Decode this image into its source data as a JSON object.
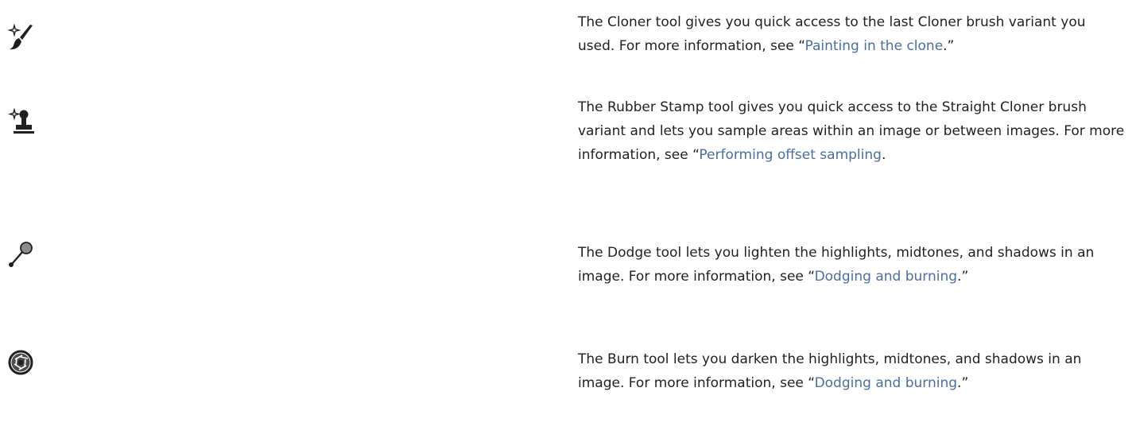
{
  "tools": [
    {
      "icon": "cloner-icon",
      "t1": "The ",
      "k1": "Cloner",
      "t2": " tool gives you quick access to the last Cloner brush variant you used. For more information, see “",
      "link": "Painting in the clone",
      "t3": ".”"
    },
    {
      "icon": "rubber-stamp-icon",
      "t1": "The ",
      "k1": "Rubber Stamp",
      "t2": " tool gives you quick access to the ",
      "k2": "Straight Cloner",
      "t3": " brush variant and lets you sample areas within an image or between images. For more information, see “",
      "link": "Performing offset sampling",
      "t4": "."
    },
    {
      "icon": "dodge-icon",
      "t1": "The ",
      "k1": "Dodge",
      "t2": " tool lets you lighten the highlights, midtones, and shadows in an image. For more information, see “",
      "link": "Dodging and burning",
      "t3": ".”"
    },
    {
      "icon": "burn-icon",
      "t1": "The ",
      "k1": "Burn",
      "t2": " tool lets you darken the highlights, midtones, and shadows in an image. For more information, see “",
      "link": "Dodging and burning",
      "t3": ".”"
    }
  ],
  "colors": {
    "text": "#231f20",
    "link": "#4a6ea0"
  }
}
